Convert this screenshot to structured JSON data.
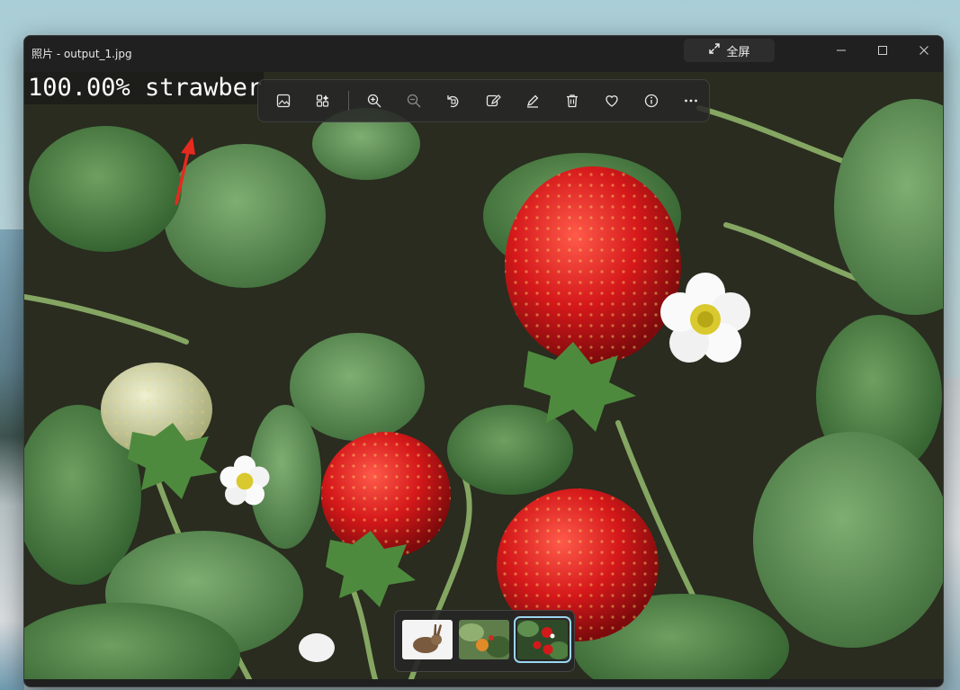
{
  "window": {
    "title": "照片 - output_1.jpg",
    "fullscreen_label": "全屏"
  },
  "viewer": {
    "overlay_text": "100.00% strawber"
  },
  "toolbar": {
    "buttons": [
      "view-image",
      "collection",
      "zoom-in",
      "zoom-out",
      "rotate",
      "edit-image",
      "draw",
      "delete",
      "favorite",
      "info",
      "more"
    ]
  },
  "filmstrip": {
    "selected_index": 2,
    "thumbnails": [
      "rabbit",
      "fruit",
      "strawberries"
    ]
  }
}
